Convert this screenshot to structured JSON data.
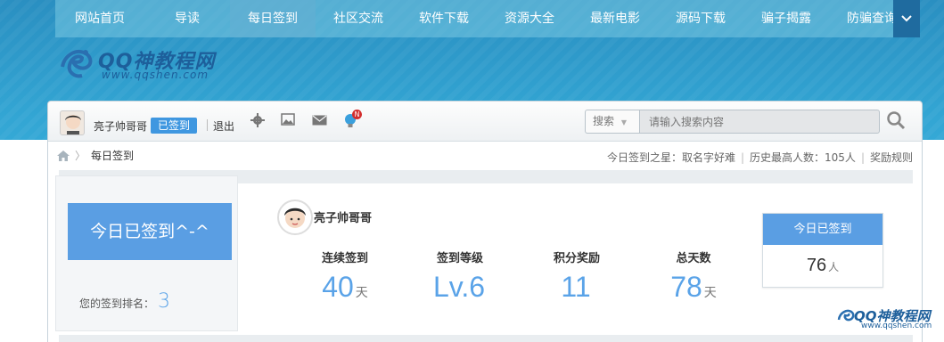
{
  "nav": {
    "items": [
      "网站首页",
      "导读",
      "每日签到",
      "社区交流",
      "软件下载",
      "资源大全",
      "最新电影",
      "源码下载",
      "骗子揭露",
      "防骗查询"
    ],
    "active_index": 2,
    "more_icon": "chevron-down-icon"
  },
  "logo": {
    "text": "QQ神教程网",
    "url": "www.qqshen.com"
  },
  "toolbar": {
    "username": "亮子帅哥哥",
    "signed_badge": "已签到",
    "logout": "退出",
    "icons": [
      "gear-icon",
      "image-icon",
      "mail-icon",
      "bulb-icon"
    ],
    "notif_badge": "N",
    "search_select": "搜索",
    "search_placeholder": "请输入搜索内容"
  },
  "breadcrumb": {
    "current": "每日签到"
  },
  "header_info": {
    "star_label": "今日签到之星：取名字好难",
    "record_label": "历史最高人数：105人",
    "rules_label": "奖励规则"
  },
  "checkin": {
    "today_button": "今日已签到^-^",
    "rank_label": "您的签到排名：",
    "rank_value": "3",
    "user": "亮子帅哥哥",
    "stats": [
      {
        "label": "连续签到",
        "value": "40",
        "unit": "天"
      },
      {
        "label": "签到等级",
        "value": "Lv.6",
        "unit": ""
      },
      {
        "label": "积分奖励",
        "value": "11",
        "unit": ""
      },
      {
        "label": "总天数",
        "value": "78",
        "unit": "天"
      }
    ],
    "today_box_title": "今日已签到",
    "today_box_count": "76",
    "today_box_unit": "人"
  },
  "watermark": {
    "text": "QQ神教程网",
    "url": "www.qqshen.com"
  },
  "colors": {
    "accent": "#5a9ee3",
    "nav_bg": "#33a6d4",
    "dark_blue": "#1f6b9f"
  }
}
